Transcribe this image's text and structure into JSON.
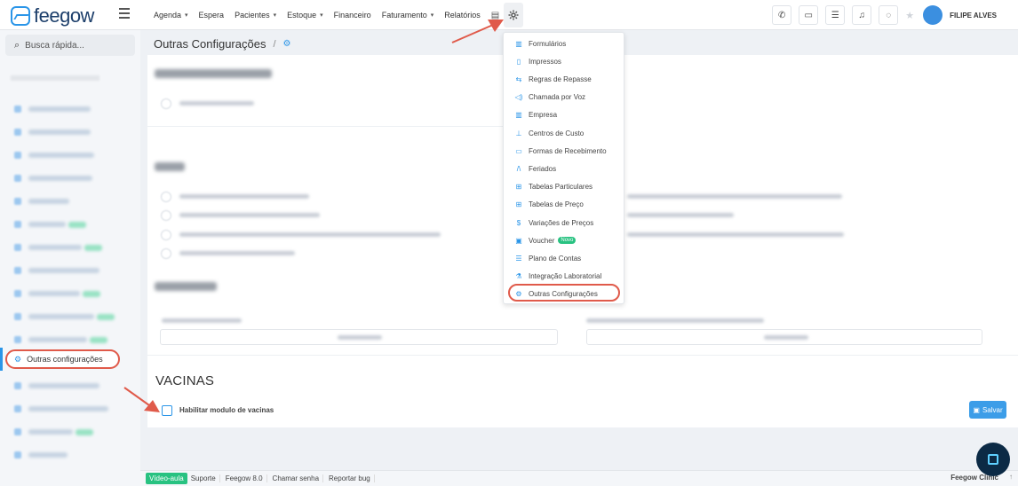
{
  "app": {
    "brand": "feegow"
  },
  "nav": {
    "items": [
      {
        "label": "Agenda",
        "dropdown": true
      },
      {
        "label": "Espera",
        "dropdown": false
      },
      {
        "label": "Pacientes",
        "dropdown": true
      },
      {
        "label": "Estoque",
        "dropdown": true
      },
      {
        "label": "Financeiro",
        "dropdown": false
      },
      {
        "label": "Faturamento",
        "dropdown": true
      },
      {
        "label": "Relatórios",
        "dropdown": false
      }
    ],
    "caret": "▾",
    "report_icon": "document-icon",
    "settings_icon": "gear-icon"
  },
  "user": {
    "name": "FILIPE ALVES"
  },
  "search": {
    "placeholder": "Busca rápida...",
    "glyph": "⌕"
  },
  "sidebar": {
    "active_label": "Outras configurações"
  },
  "breadcrumb": {
    "title": "Outras Configurações",
    "sep": "/"
  },
  "dropdown": {
    "items": [
      {
        "icon": "▥",
        "label": "Formulários"
      },
      {
        "icon": "▯",
        "label": "Impressos"
      },
      {
        "icon": "⇆",
        "label": "Regras de Repasse"
      },
      {
        "icon": "◁)",
        "label": "Chamada por Voz"
      },
      {
        "icon": "▥",
        "label": "Empresa"
      },
      {
        "icon": "⊥",
        "label": "Centros de Custo"
      },
      {
        "icon": "▭",
        "label": "Formas de Recebimento"
      },
      {
        "icon": "/\\",
        "label": "Feriados"
      },
      {
        "icon": "⊞",
        "label": "Tabelas Particulares"
      },
      {
        "icon": "⊞",
        "label": "Tabelas de Preço"
      },
      {
        "icon": "$",
        "label": "Variações de Preços"
      },
      {
        "icon": "▣",
        "label": "Voucher",
        "badge": "Novo"
      },
      {
        "icon": "☰",
        "label": "Plano de Contas"
      },
      {
        "icon": "⚗",
        "label": "Integração Laboratorial"
      },
      {
        "icon": "⚙",
        "label": "Outras Configurações"
      }
    ]
  },
  "vacinas": {
    "title": "VACINAS",
    "checkbox_label": "Habilitar modulo de vacinas",
    "save_label": "Salvar"
  },
  "footer": {
    "video": "Vídeo-aula",
    "items": [
      "Suporte",
      "Feegow 8.0",
      "Chamar senha",
      "Reportar bug"
    ],
    "clinic": "Feegow Clinic",
    "up_glyph": "↑"
  },
  "colors": {
    "accent": "#2a95e8",
    "highlight": "#e05a4a",
    "success": "#28c281"
  }
}
